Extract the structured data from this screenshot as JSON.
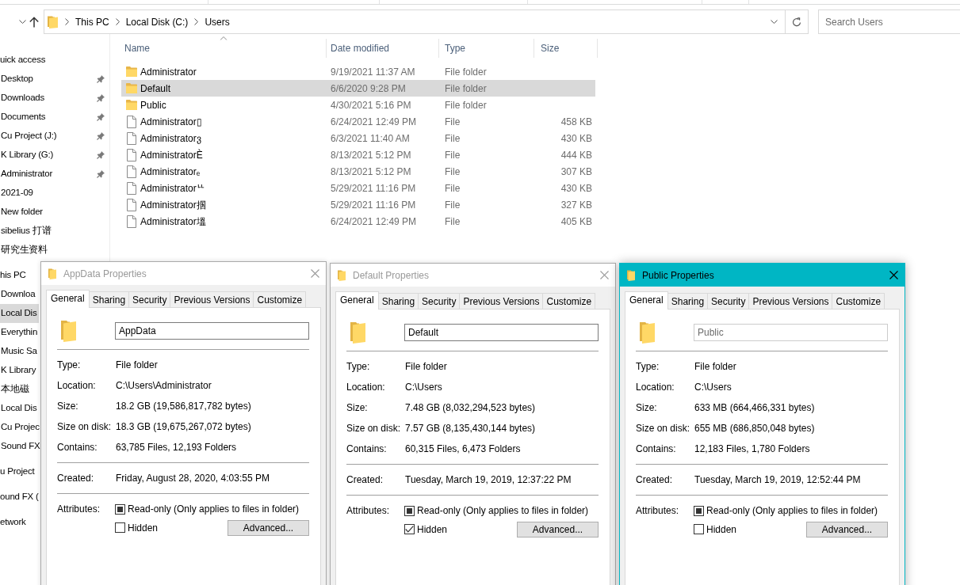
{
  "address_bar": {
    "segments": [
      "This PC",
      "Local Disk (C:)",
      "Users"
    ]
  },
  "search": {
    "placeholder": "Search Users"
  },
  "navigation": [
    {
      "label": "uick access",
      "selected": false,
      "children": [
        {
          "label": "Desktop",
          "pinned": true,
          "selected": false
        },
        {
          "label": "Downloads",
          "pinned": true,
          "selected": false
        },
        {
          "label": "Documents",
          "pinned": true,
          "selected": false
        },
        {
          "label": "Cu Project (J:)",
          "pinned": true,
          "selected": false
        },
        {
          "label": "K Library (G:)",
          "pinned": true,
          "selected": false
        },
        {
          "label": "Administrator",
          "pinned": true,
          "selected": false
        },
        {
          "label": "2021-09",
          "pinned": false,
          "selected": false
        },
        {
          "label": "New folder",
          "pinned": false,
          "selected": false
        },
        {
          "label": "sibelius 打谱",
          "pinned": false,
          "selected": false
        },
        {
          "label": "研究生资料",
          "pinned": false,
          "selected": false
        }
      ]
    },
    {
      "label": "his PC",
      "selected": false,
      "children": [
        {
          "label": "Downloa",
          "selected": false
        },
        {
          "label": "Local Dis",
          "selected": true
        },
        {
          "label": "Everythin",
          "selected": false
        },
        {
          "label": "Music Sa",
          "selected": false
        },
        {
          "label": "K Library",
          "selected": false
        },
        {
          "label": "本地磁",
          "selected": false
        },
        {
          "label": "Local Dis",
          "selected": false
        },
        {
          "label": "Cu Projec",
          "selected": false
        },
        {
          "label": "Sound FX",
          "selected": false
        }
      ]
    },
    {
      "label": "u Project",
      "selected": false
    },
    {
      "label": "ound FX (",
      "selected": false
    },
    {
      "label": "etwork",
      "selected": false
    }
  ],
  "file_list": {
    "columns": [
      {
        "label": "Name",
        "sorted": true
      },
      {
        "label": "Date modified",
        "sorted": false
      },
      {
        "label": "Type",
        "sorted": false
      },
      {
        "label": "Size",
        "sorted": false
      }
    ],
    "rows": [
      {
        "kind": "folder",
        "name": "Administrator",
        "date": "9/19/2021 11:37 AM",
        "type": "File folder",
        "selected": false
      },
      {
        "kind": "folder",
        "name": "Default",
        "date": "6/6/2020 9:28 PM",
        "type": "File folder",
        "selected": true
      },
      {
        "kind": "folder",
        "name": "Public",
        "date": "4/30/2021 5:16 PM",
        "type": "File folder",
        "selected": false
      },
      {
        "kind": "file",
        "name": "Administrator▯",
        "date": "6/24/2021 12:49 PM",
        "type": "File",
        "size": "458 KB",
        "selected": false
      },
      {
        "kind": "file",
        "name": "Administratorვ",
        "date": "6/3/2021 11:40 AM",
        "type": "File",
        "size": "430 KB",
        "selected": false
      },
      {
        "kind": "file",
        "name": "AdministratorÈ",
        "date": "8/13/2021 5:12 PM",
        "type": "File",
        "size": "444 KB",
        "selected": false
      },
      {
        "kind": "file",
        "name": "Administratorₑ",
        "date": "8/13/2021 5:12 PM",
        "type": "File",
        "size": "307 KB",
        "selected": false
      },
      {
        "kind": "file",
        "name": "Administratorᄔ",
        "date": "5/29/2021 11:16 PM",
        "type": "File",
        "size": "430 KB",
        "selected": false
      },
      {
        "kind": "file",
        "name": "Administrator掴",
        "date": "5/29/2021 11:16 PM",
        "type": "File",
        "size": "327 KB",
        "selected": false
      },
      {
        "kind": "file",
        "name": "Administrator塭",
        "date": "6/24/2021 12:49 PM",
        "type": "File",
        "size": "405 KB",
        "selected": false
      }
    ]
  },
  "dialogs": [
    {
      "title": "AppData Properties",
      "active": false,
      "tabs": [
        {
          "label": "General",
          "selected": true
        },
        {
          "label": "Sharing",
          "selected": false
        },
        {
          "label": "Security",
          "selected": false
        },
        {
          "label": "Previous Versions",
          "selected": false
        },
        {
          "label": "Customize",
          "selected": false
        }
      ],
      "name_field": {
        "value": "AppData",
        "disabled": false
      },
      "details": [
        [
          {
            "label": "Type:",
            "value": "File folder"
          },
          {
            "label": "Location:",
            "value": "C:\\Users\\Administrator"
          },
          {
            "label": "Size:",
            "value": "18.2 GB (19,586,817,782 bytes)"
          },
          {
            "label": "Size on disk:",
            "value": "18.3 GB (19,675,267,072 bytes)"
          },
          {
            "label": "Contains:",
            "value": "63,785 Files, 12,193 Folders"
          }
        ],
        [
          {
            "label": "Created:",
            "value": "Friday, August 28, 2020, 4:03:55 PM"
          }
        ]
      ],
      "attributes": {
        "label": "Attributes:",
        "checkboxes": [
          {
            "label": "Read-only (Only applies to files in folder)",
            "checked": false,
            "indeterminate": true
          },
          {
            "label": "Hidden",
            "checked": false,
            "indeterminate": false
          }
        ],
        "button": "Advanced..."
      }
    },
    {
      "title": "Default Properties",
      "active": false,
      "tabs": [
        {
          "label": "General",
          "selected": true
        },
        {
          "label": "Sharing",
          "selected": false
        },
        {
          "label": "Security",
          "selected": false
        },
        {
          "label": "Previous Versions",
          "selected": false
        },
        {
          "label": "Customize",
          "selected": false
        }
      ],
      "name_field": {
        "value": "Default",
        "disabled": false
      },
      "details": [
        [
          {
            "label": "Type:",
            "value": "File folder"
          },
          {
            "label": "Location:",
            "value": "C:\\Users"
          },
          {
            "label": "Size:",
            "value": "7.48 GB (8,032,294,523 bytes)"
          },
          {
            "label": "Size on disk:",
            "value": "7.57 GB (8,135,430,144 bytes)"
          },
          {
            "label": "Contains:",
            "value": "60,315 Files, 6,473 Folders"
          }
        ],
        [
          {
            "label": "Created:",
            "value": "Tuesday, March 19, 2019, 12:37:22 PM"
          }
        ]
      ],
      "attributes": {
        "label": "Attributes:",
        "checkboxes": [
          {
            "label": "Read-only (Only applies to files in folder)",
            "checked": false,
            "indeterminate": true
          },
          {
            "label": "Hidden",
            "checked": true,
            "indeterminate": false
          }
        ],
        "button": "Advanced..."
      }
    },
    {
      "title": "Public Properties",
      "active": true,
      "tabs": [
        {
          "label": "General",
          "selected": true
        },
        {
          "label": "Sharing",
          "selected": false
        },
        {
          "label": "Security",
          "selected": false
        },
        {
          "label": "Previous Versions",
          "selected": false
        },
        {
          "label": "Customize",
          "selected": false
        }
      ],
      "name_field": {
        "value": "Public",
        "disabled": true
      },
      "details": [
        [
          {
            "label": "Type:",
            "value": "File folder"
          },
          {
            "label": "Location:",
            "value": "C:\\Users"
          },
          {
            "label": "Size:",
            "value": "633 MB (664,466,331 bytes)"
          },
          {
            "label": "Size on disk:",
            "value": "655 MB (686,850,048 bytes)"
          },
          {
            "label": "Contains:",
            "value": "12,183 Files, 1,780 Folders"
          }
        ],
        [
          {
            "label": "Created:",
            "value": "Tuesday, March 19, 2019, 12:52:44 PM"
          }
        ]
      ],
      "attributes": {
        "label": "Attributes:",
        "checkboxes": [
          {
            "label": "Read-only (Only applies to files in folder)",
            "checked": false,
            "indeterminate": true
          },
          {
            "label": "Hidden",
            "checked": false,
            "indeterminate": false
          }
        ],
        "button": "Advanced..."
      }
    }
  ]
}
